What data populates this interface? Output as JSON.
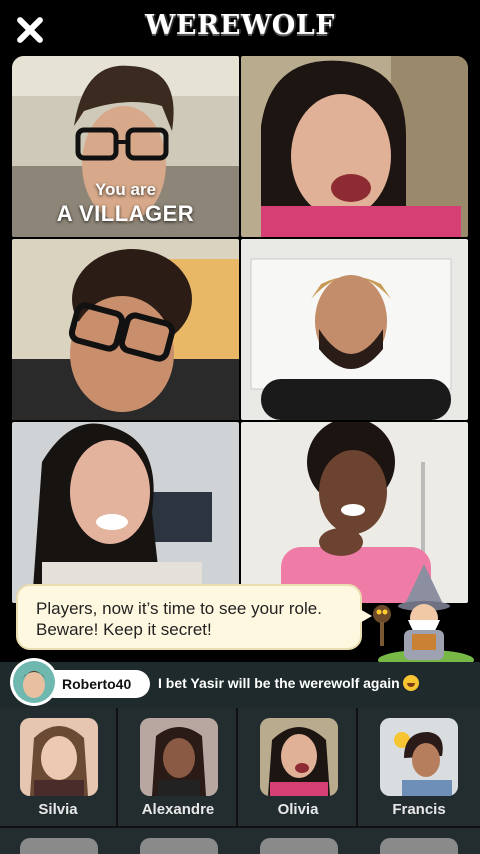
{
  "app": {
    "title": "WEREWOLF"
  },
  "role": {
    "prefix": "You are",
    "name": "A VILLAGER"
  },
  "narrator": {
    "message": "Players, now it’s time to see your role. Beware! Keep it secret!"
  },
  "chat": {
    "username": "Roberto40",
    "message": "I bet Yasir will be the werewolf again",
    "emoji": "sweat-smile-emoji"
  },
  "players": [
    {
      "name": "Silvia"
    },
    {
      "name": "Alexandre"
    },
    {
      "name": "Olivia"
    },
    {
      "name": "Francis"
    }
  ],
  "colors": {
    "narrator_bubble": "#fff8e1",
    "chat_bar": "#1e2a2c",
    "players_panel": "#232d2f"
  }
}
